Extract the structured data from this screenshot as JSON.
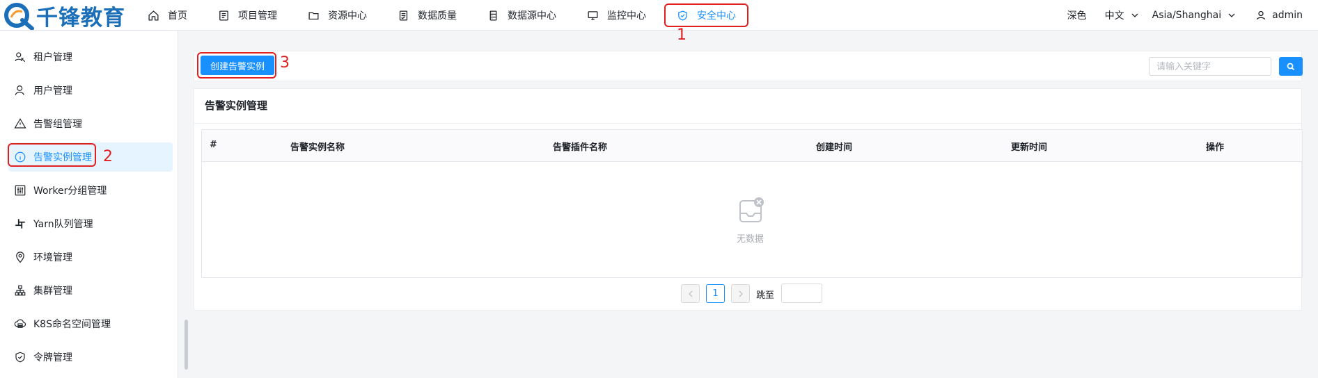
{
  "header": {
    "logo_text": "千锋教育",
    "nav": [
      {
        "label": "首页",
        "icon": "home-icon"
      },
      {
        "label": "项目管理",
        "icon": "project-list-icon"
      },
      {
        "label": "资源中心",
        "icon": "folder-icon"
      },
      {
        "label": "数据质量",
        "icon": "document-check-icon"
      },
      {
        "label": "数据源中心",
        "icon": "database-icon"
      },
      {
        "label": "监控中心",
        "icon": "monitor-icon"
      },
      {
        "label": "安全中心",
        "icon": "shield-check-icon",
        "active": true
      }
    ],
    "theme": "深色",
    "language": "中文",
    "timezone": "Asia/Shanghai",
    "user": "admin"
  },
  "annotations": {
    "one": "1",
    "two": "2",
    "three": "3"
  },
  "sidebar": {
    "items": [
      {
        "label": "租户管理",
        "icon": "tenant-icon"
      },
      {
        "label": "用户管理",
        "icon": "user-icon"
      },
      {
        "label": "告警组管理",
        "icon": "warning-icon"
      },
      {
        "label": "告警实例管理",
        "icon": "info-circle-icon",
        "active": true
      },
      {
        "label": "Worker分组管理",
        "icon": "sliders-icon"
      },
      {
        "label": "Yarn队列管理",
        "icon": "slack-icon"
      },
      {
        "label": "环境管理",
        "icon": "location-icon"
      },
      {
        "label": "集群管理",
        "icon": "cluster-icon"
      },
      {
        "label": "K8S命名空间管理",
        "icon": "cloud-server-icon"
      },
      {
        "label": "令牌管理",
        "icon": "shield-icon"
      }
    ]
  },
  "toolbar": {
    "create_label": "创建告警实例",
    "search_placeholder": "请输入关键字"
  },
  "card": {
    "title": "告警实例管理",
    "columns": [
      "#",
      "告警实例名称",
      "告警插件名称",
      "创建时间",
      "更新时间",
      "操作"
    ],
    "empty_text": "无数据"
  },
  "pagination": {
    "current_page": "1",
    "jump_label": "跳至"
  },
  "colors": {
    "primary": "#1890ff",
    "highlight": "#e02020"
  }
}
